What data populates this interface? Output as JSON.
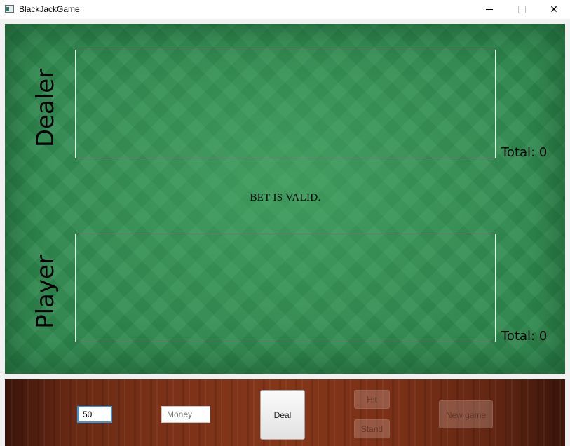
{
  "window": {
    "title": "BlackJackGame"
  },
  "table": {
    "dealer": {
      "label": "Dealer",
      "total": "Total: 0"
    },
    "player": {
      "label": "Player",
      "total": "Total: 0"
    },
    "status": "BET IS VALID."
  },
  "controls": {
    "bet_value": "50",
    "money_placeholder": "Money",
    "deal_label": "Deal",
    "hit_label": "Hit",
    "stand_label": "Stand",
    "new_game_label": "New game"
  },
  "colors": {
    "felt": "#2f8a4f",
    "wood": "#7c3218",
    "focus_border": "#3c96d6"
  }
}
